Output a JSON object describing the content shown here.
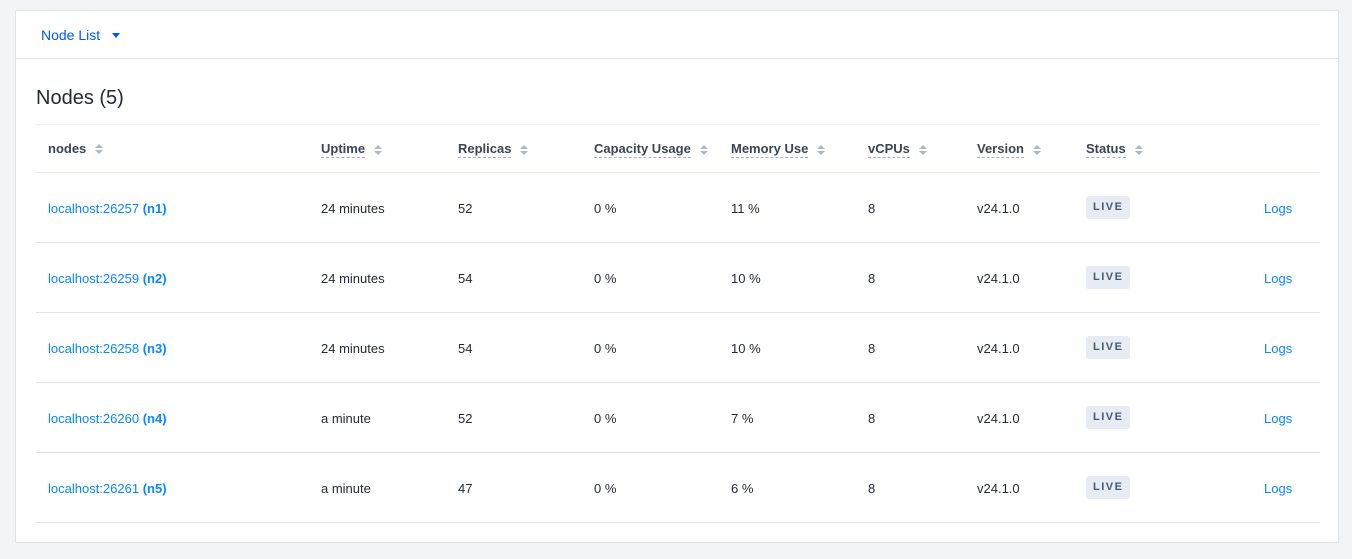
{
  "topbar": {
    "dropdown_label": "Node List"
  },
  "title": "Nodes (5)",
  "columns": {
    "nodes": "nodes",
    "uptime": "Uptime",
    "replicas": "Replicas",
    "capacity": "Capacity Usage",
    "memory": "Memory Use",
    "vcpus": "vCPUs",
    "version": "Version",
    "status": "Status"
  },
  "rows": [
    {
      "address": "localhost:26257",
      "id": "(n1)",
      "uptime": "24 minutes",
      "replicas": "52",
      "capacity": "0 %",
      "memory": "11 %",
      "vcpus": "8",
      "version": "v24.1.0",
      "status": "LIVE",
      "logs": "Logs"
    },
    {
      "address": "localhost:26259",
      "id": "(n2)",
      "uptime": "24 minutes",
      "replicas": "54",
      "capacity": "0 %",
      "memory": "10 %",
      "vcpus": "8",
      "version": "v24.1.0",
      "status": "LIVE",
      "logs": "Logs"
    },
    {
      "address": "localhost:26258",
      "id": "(n3)",
      "uptime": "24 minutes",
      "replicas": "54",
      "capacity": "0 %",
      "memory": "10 %",
      "vcpus": "8",
      "version": "v24.1.0",
      "status": "LIVE",
      "logs": "Logs"
    },
    {
      "address": "localhost:26260",
      "id": "(n4)",
      "uptime": "a minute",
      "replicas": "52",
      "capacity": "0 %",
      "memory": "7 %",
      "vcpus": "8",
      "version": "v24.1.0",
      "status": "LIVE",
      "logs": "Logs"
    },
    {
      "address": "localhost:26261",
      "id": "(n5)",
      "uptime": "a minute",
      "replicas": "47",
      "capacity": "0 %",
      "memory": "6 %",
      "vcpus": "8",
      "version": "v24.1.0",
      "status": "LIVE",
      "logs": "Logs"
    }
  ],
  "colors": {
    "link": "#0788ff",
    "dropdown": "#0055ff",
    "badge_bg": "#e7ebf3",
    "badge_text": "#475872"
  }
}
